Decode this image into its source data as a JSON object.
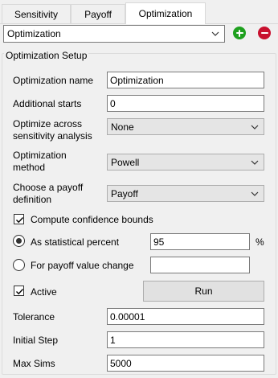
{
  "tabs": [
    {
      "label": "Sensitivity"
    },
    {
      "label": "Payoff"
    },
    {
      "label": "Optimization",
      "active": true
    }
  ],
  "selector": {
    "value": "Optimization"
  },
  "colors": {
    "add": "#1ea01e",
    "remove": "#c8102e"
  },
  "icons": {
    "add": "plus-circle-icon",
    "remove": "minus-circle-icon"
  },
  "setup": {
    "title": "Optimization Setup",
    "name_label": "Optimization name",
    "name_value": "Optimization",
    "starts_label": "Additional starts",
    "starts_value": "0",
    "across_label_1": "Optimize across",
    "across_label_2": "sensitivity analysis",
    "across_value": "None",
    "method_label_1": "Optimization",
    "method_label_2": "method",
    "method_value": "Powell",
    "payoff_label_1": "Choose a payoff",
    "payoff_label_2": "definition",
    "payoff_value": "Payoff",
    "confidence_label": "Compute confidence bounds",
    "confidence_checked": true,
    "stat_label": "As statistical percent",
    "stat_value": "95",
    "stat_unit": "%",
    "stat_selected": true,
    "payoff_change_label": "For payoff value change",
    "payoff_change_value": "",
    "active_label": "Active",
    "active_checked": true,
    "run_label": "Run",
    "tolerance_label": "Tolerance",
    "tolerance_value": "0.00001",
    "initial_step_label": "Initial Step",
    "initial_step_value": "1",
    "max_sims_label": "Max Sims",
    "max_sims_value": "5000"
  }
}
